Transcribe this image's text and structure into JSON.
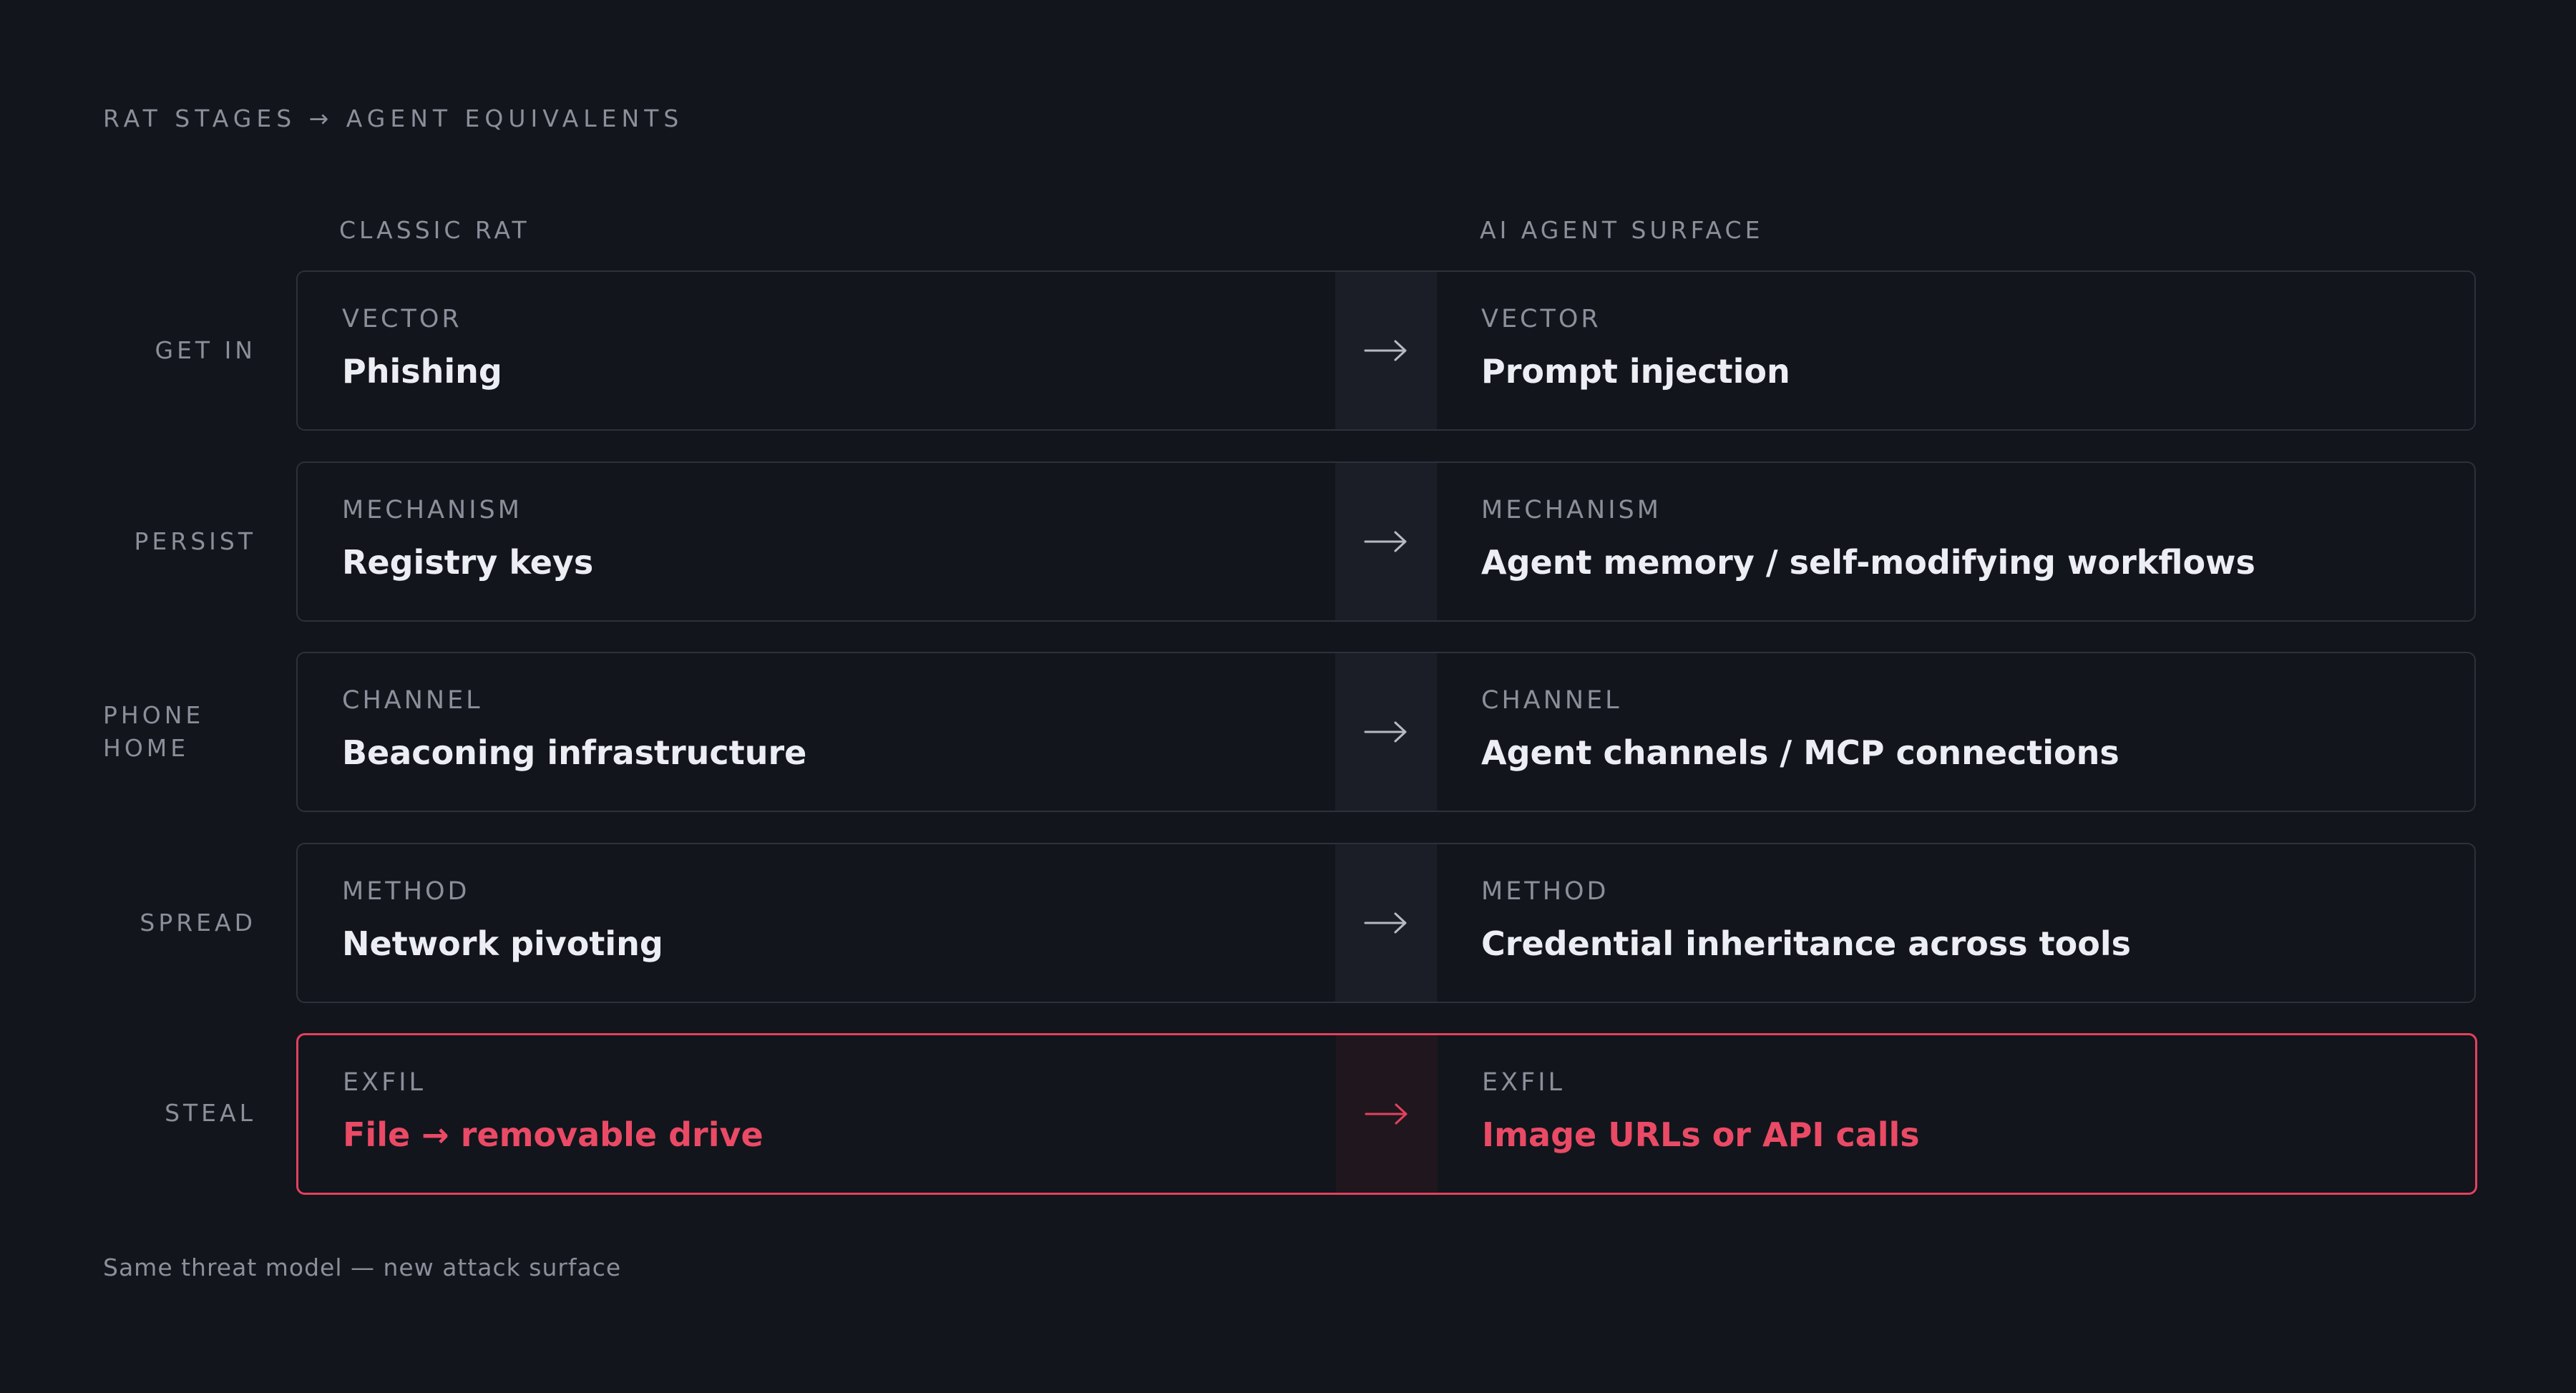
{
  "title": "RAT STAGES → AGENT EQUIVALENTS",
  "columns": {
    "left": "CLASSIC RAT",
    "right": "AI AGENT SURFACE"
  },
  "rows": [
    {
      "stage": "GET IN",
      "left_kind": "VECTOR",
      "left_value": "Phishing",
      "right_kind": "VECTOR",
      "right_value": "Prompt injection",
      "highlight": false
    },
    {
      "stage": "PERSIST",
      "left_kind": "MECHANISM",
      "left_value": "Registry keys",
      "right_kind": "MECHANISM",
      "right_value": "Agent memory / self-modifying workflows",
      "highlight": false
    },
    {
      "stage": "PHONE HOME",
      "left_kind": "CHANNEL",
      "left_value": "Beaconing infrastructure",
      "right_kind": "CHANNEL",
      "right_value": "Agent channels / MCP connections",
      "highlight": false
    },
    {
      "stage": "SPREAD",
      "left_kind": "METHOD",
      "left_value": "Network pivoting",
      "right_kind": "METHOD",
      "right_value": "Credential inheritance across tools",
      "highlight": false
    },
    {
      "stage": "STEAL",
      "left_kind": "EXFIL",
      "left_value": "File → removable drive",
      "right_kind": "EXFIL",
      "right_value": "Image URLs or API calls",
      "highlight": true
    }
  ],
  "footnote": "Same threat model — new attack surface",
  "colors": {
    "background": "#12151c",
    "accent_red": "#e5405e",
    "muted_text": "#8b8f9a",
    "arrow": "arrow-right-icon"
  }
}
